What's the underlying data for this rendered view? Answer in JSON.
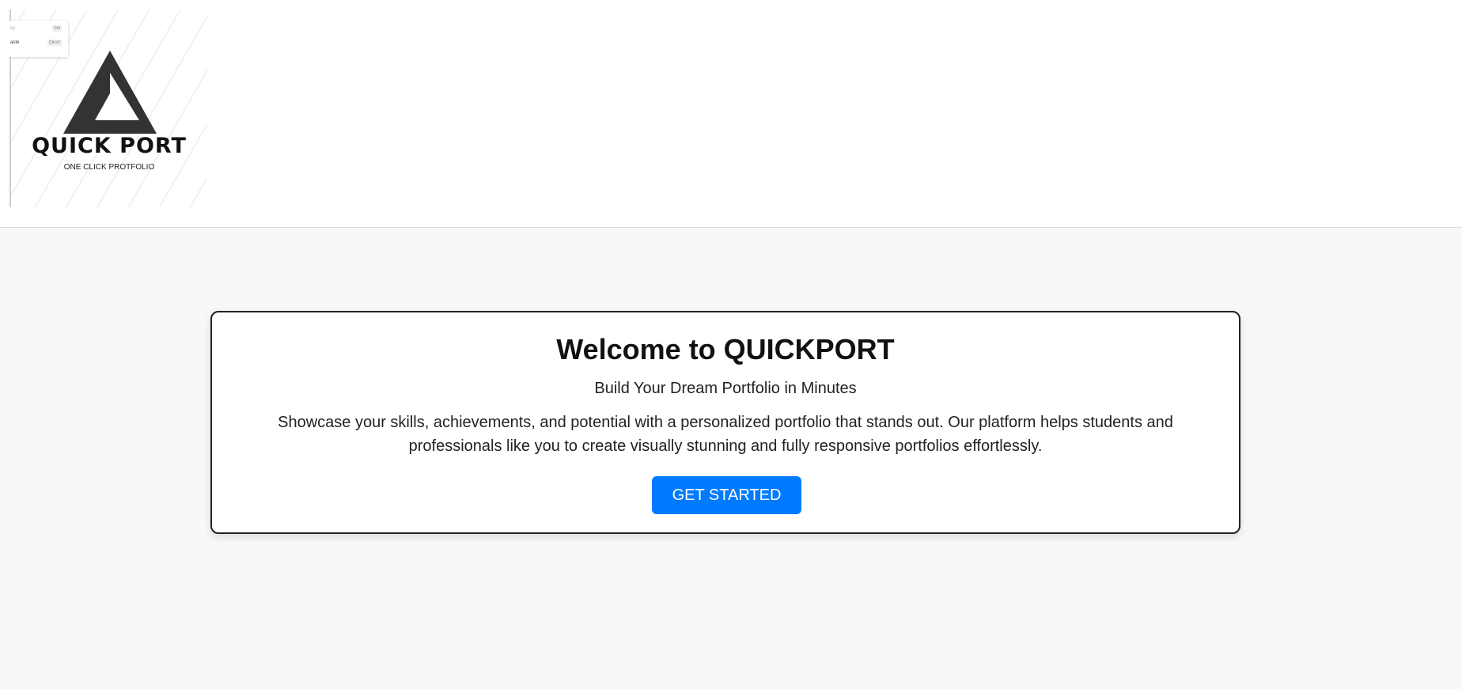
{
  "header": {
    "logo": {
      "title": "QUICK PORT",
      "tagline": "ONE CLICK PROTFOLIO",
      "menu_fragment": [
        {
          "label": "ey",
          "shortcut": "Ctrl"
        },
        {
          "label": "aste",
          "shortcut": "Ctrl+V"
        }
      ]
    }
  },
  "hero": {
    "title": "Welcome to QUICKPORT",
    "subtitle": "Build Your Dream Portfolio in Minutes",
    "description": "Showcase your skills, achievements, and potential with a personalized portfolio that stands out. Our platform helps students and professionals like you to create visually stunning and fully responsive portfolios effortlessly.",
    "cta_label": "GET STARTED"
  },
  "colors": {
    "accent": "#007bff",
    "page_background": "#f8f8f8",
    "logo_mark": "#333333"
  }
}
